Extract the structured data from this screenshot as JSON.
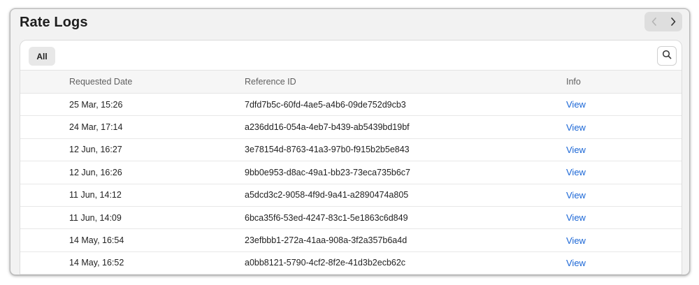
{
  "window": {
    "title": "Rate Logs"
  },
  "toolbar": {
    "nav_prev_icon": "chevron-left-icon",
    "nav_next_icon": "chevron-right-icon",
    "filter_label": "All",
    "search_icon": "search-icon"
  },
  "table": {
    "columns": [
      "Requested Date",
      "Reference ID",
      "Info"
    ],
    "rows": [
      {
        "date": "25 Mar, 15:26",
        "reference_id": "7dfd7b5c-60fd-4ae5-a4b6-09de752d9cb3",
        "info": "View"
      },
      {
        "date": "24 Mar, 17:14",
        "reference_id": "a236dd16-054a-4eb7-b439-ab5439bd19bf",
        "info": "View"
      },
      {
        "date": "12 Jun, 16:27",
        "reference_id": "3e78154d-8763-41a3-97b0-f915b2b5e843",
        "info": "View"
      },
      {
        "date": "12 Jun, 16:26",
        "reference_id": "9bb0e953-d8ac-49a1-bb23-73eca735b6c7",
        "info": "View"
      },
      {
        "date": "11 Jun, 14:12",
        "reference_id": "a5dcd3c2-9058-4f9d-9a41-a2890474a805",
        "info": "View"
      },
      {
        "date": "11 Jun, 14:09",
        "reference_id": "6bca35f6-53ed-4247-83c1-5e1863c6d849",
        "info": "View"
      },
      {
        "date": "14 May, 16:54",
        "reference_id": "23efbbb1-272a-41aa-908a-3f2a357b6a4d",
        "info": "View"
      },
      {
        "date": "14 May, 16:52",
        "reference_id": "a0bb8121-5790-4cf2-8f2e-41d3b2ecb62c",
        "info": "View"
      }
    ]
  },
  "colors": {
    "link": "#1a66d6",
    "panel_bg": "#ffffff",
    "window_bg": "#f2f2f2"
  }
}
